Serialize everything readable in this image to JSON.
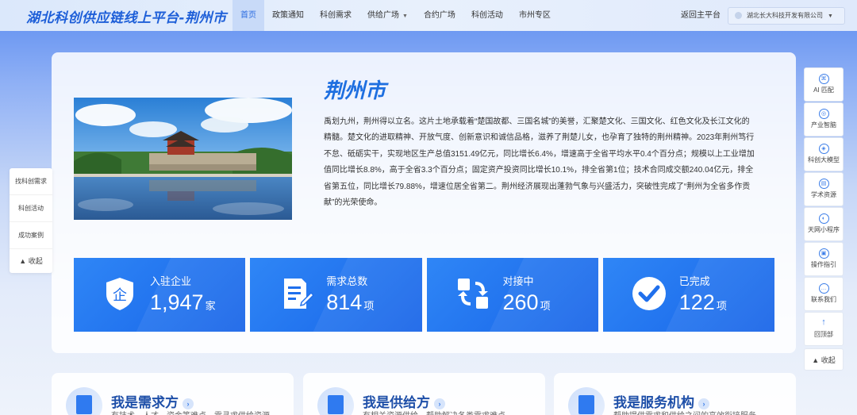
{
  "header": {
    "logo": "湖北科创供应链线上平台-荆州市",
    "nav": [
      {
        "label": "首页",
        "active": true
      },
      {
        "label": "政策通知"
      },
      {
        "label": "科创需求"
      },
      {
        "label": "供给广场",
        "dropdown": true
      },
      {
        "label": "合约广场"
      },
      {
        "label": "科创活动"
      },
      {
        "label": "市州专区"
      }
    ],
    "back_home": "返回主平台",
    "company": "湖北长大科技开发有限公司"
  },
  "main": {
    "city_title": "荆州市",
    "description": "禹划九州，荆州得以立名。这片土地承载着“楚国故都、三国名城”的美誉，汇聚楚文化、三国文化、红色文化及长江文化的精髓。楚文化的进取精神、开放气度、创新意识和诚信品格，滋养了荆楚儿女，也孕育了独特的荆州精神。2023年荆州笃行不怠、砥砺实干，实现地区生产总值3151.49亿元，同比增长6.4%，增速高于全省平均水平0.4个百分点；规模以上工业增加值同比增长8.8%，高于全省3.3个百分点；固定资产投资同比增长10.1%，排全省第1位；技术合同成交额240.04亿元，排全省第五位，同比增长79.88%，增速位居全省第二。荆州经济展现出蓬勃气象与兴盛活力，突破性完成了“荆州为全省多作贡献”的光荣使命。",
    "stats": [
      {
        "label": "入驻企业",
        "value": "1,947",
        "unit": "家",
        "icon": "enterprise-shield-icon"
      },
      {
        "label": "需求总数",
        "value": "814",
        "unit": "项",
        "icon": "document-edit-icon"
      },
      {
        "label": "对接中",
        "value": "260",
        "unit": "项",
        "icon": "exchange-arrows-icon"
      },
      {
        "label": "已完成",
        "value": "122",
        "unit": "项",
        "icon": "check-circle-icon"
      }
    ]
  },
  "side_left": {
    "items": [
      "找科创需求",
      "科创活动",
      "成功案例"
    ],
    "collapse": "收起"
  },
  "side_right": {
    "tools": [
      {
        "label": "AI 匹配",
        "icon": "ai-icon"
      },
      {
        "label": "产业智脑",
        "icon": "brain-icon"
      },
      {
        "label": "科创大模型",
        "icon": "model-icon"
      },
      {
        "label": "学术资源",
        "icon": "book-icon"
      },
      {
        "label": "天网小程序",
        "icon": "miniapp-icon"
      },
      {
        "label": "操作指引",
        "icon": "guide-icon"
      },
      {
        "label": "联系我们",
        "icon": "chat-icon"
      },
      {
        "label": "回顶部",
        "icon": "arrow-up-icon"
      }
    ],
    "collapse": "收起"
  },
  "bottom_cards": [
    {
      "title": "我是需求方",
      "subtitle": "有技术、人才、资金等难点，需寻求供给资源"
    },
    {
      "title": "我是供给方",
      "subtitle": "有相关资源供给，帮助解决各类需求难点"
    },
    {
      "title": "我是服务机构",
      "subtitle": "帮助提供需求和供给之间的高效衔接服务"
    }
  ],
  "colors": {
    "primary": "#1e6fe0",
    "stat_bg": "#1f6fec"
  }
}
